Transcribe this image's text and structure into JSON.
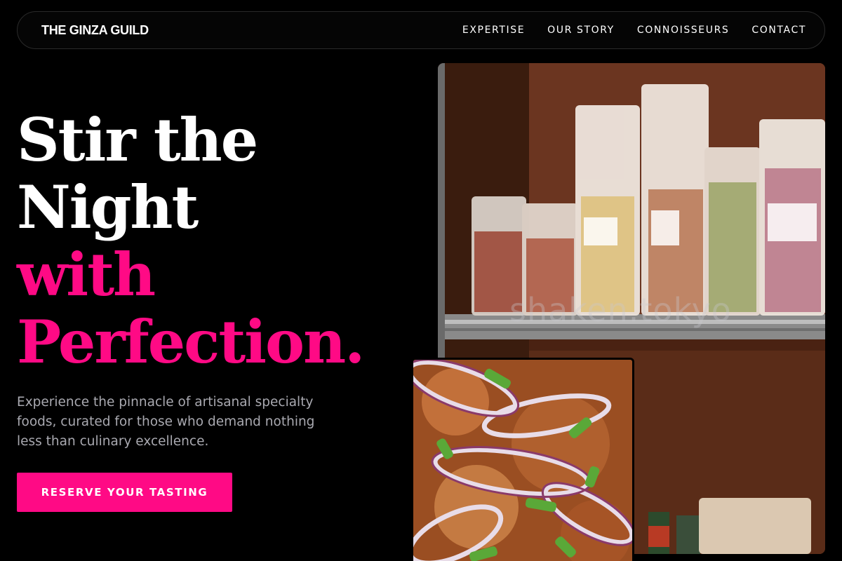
{
  "brand": "THE GINZA GUILD",
  "nav": {
    "items": [
      {
        "label": "EXPERTISE"
      },
      {
        "label": "OUR STORY"
      },
      {
        "label": "CONNOISSEURS"
      },
      {
        "label": "CONTACT"
      }
    ]
  },
  "hero": {
    "line1": "Stir the",
    "line2": "Night",
    "line3": "with",
    "line4": "Perfection.",
    "subtext": "Experience the pinnacle of artisanal specialty foods, curated for those who demand nothing less than culinary excellence.",
    "cta_label": "RESERVE YOUR TASTING"
  },
  "images": {
    "main_watermark": "shaken.tokyo",
    "main_icon": "pasta-shelf-photo",
    "inset_icon": "onion-salad-photo"
  },
  "colors": {
    "accent": "#ff0a85",
    "background": "#000000",
    "muted_text": "#a9a9b0"
  }
}
